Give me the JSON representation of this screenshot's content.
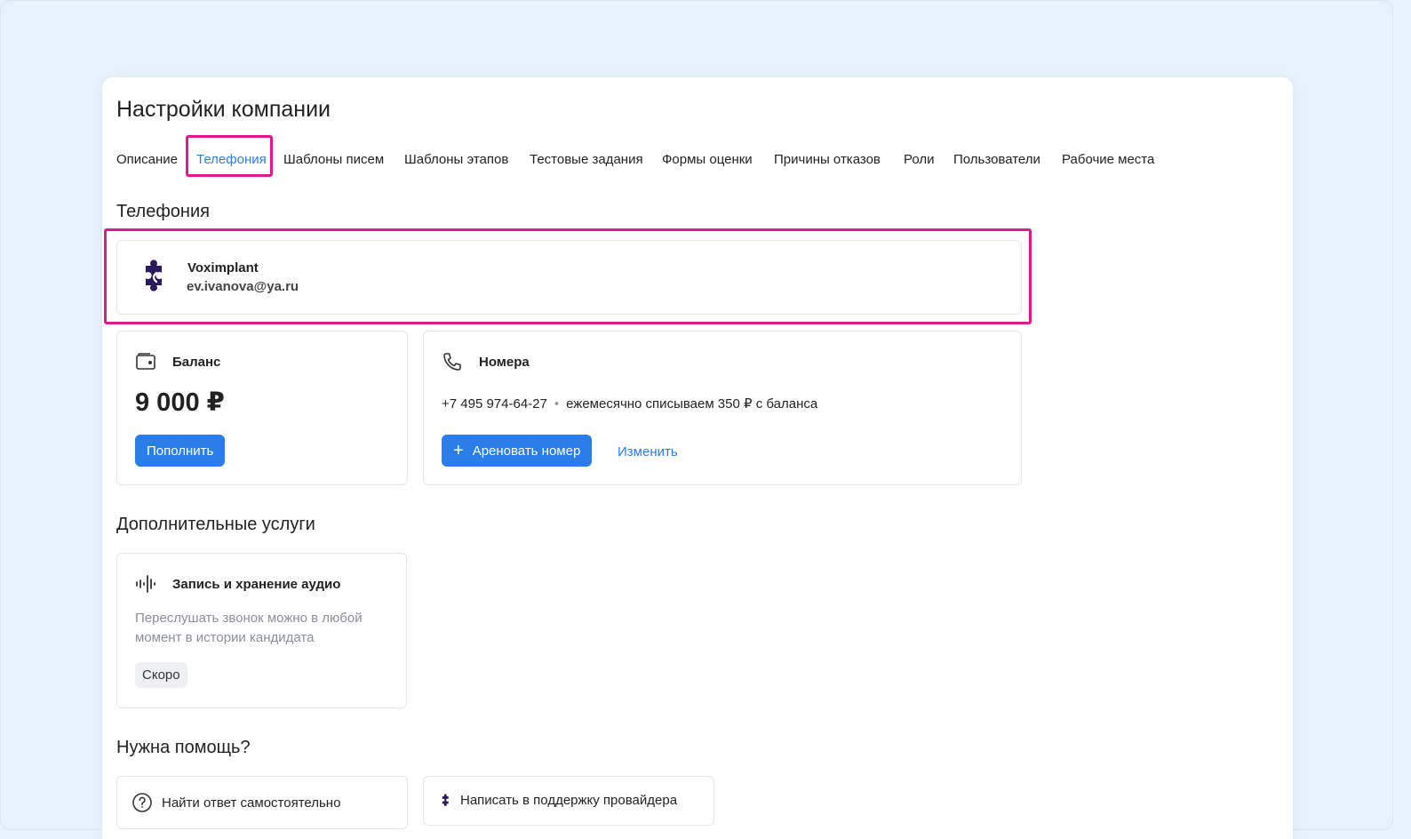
{
  "page": {
    "title": "Настройки компании"
  },
  "tabs": [
    {
      "label": "Описание"
    },
    {
      "label": "Телефония",
      "active": true
    },
    {
      "label": "Шаблоны писем"
    },
    {
      "label": "Шаблоны этапов"
    },
    {
      "label": "Тестовые задания"
    },
    {
      "label": "Формы оценки"
    },
    {
      "label": "Причины отказов"
    },
    {
      "label": "Роли"
    },
    {
      "label": "Пользователи"
    },
    {
      "label": "Рабочие места"
    }
  ],
  "telephony": {
    "title": "Телефония",
    "provider": {
      "name": "Voximplant",
      "email": "ev.ivanova@ya.ru",
      "icon": "puzzle-icon"
    },
    "balance": {
      "label": "Баланс",
      "value": "9 000 ₽",
      "topup_label": "Пополнить",
      "icon": "wallet-icon"
    },
    "numbers": {
      "label": "Номера",
      "phone": "+7 495 974-64-27",
      "separator": "•",
      "note": "ежемесячно списываем 350 ₽ с баланса",
      "rent_label": "Ареновать номер",
      "change_label": "Изменить",
      "icon": "phone-icon"
    }
  },
  "services": {
    "title": "Дополнительные услуги",
    "recording": {
      "label": "Запись и хранение аудио",
      "description": "Переслушать звонок можно в любой момент в истории кандидата",
      "badge": "Скоро",
      "icon": "audio-wave-icon"
    }
  },
  "help": {
    "title": "Нужна помощь?",
    "self": {
      "label": "Найти ответ самостоятельно",
      "icon": "question-circle-icon"
    },
    "support": {
      "label": "Написать в поддержку провайдера",
      "icon": "puzzle-icon"
    }
  },
  "colors": {
    "accent": "#2b7de9",
    "highlight": "#e0188c",
    "provider": "#2a1a5e"
  }
}
